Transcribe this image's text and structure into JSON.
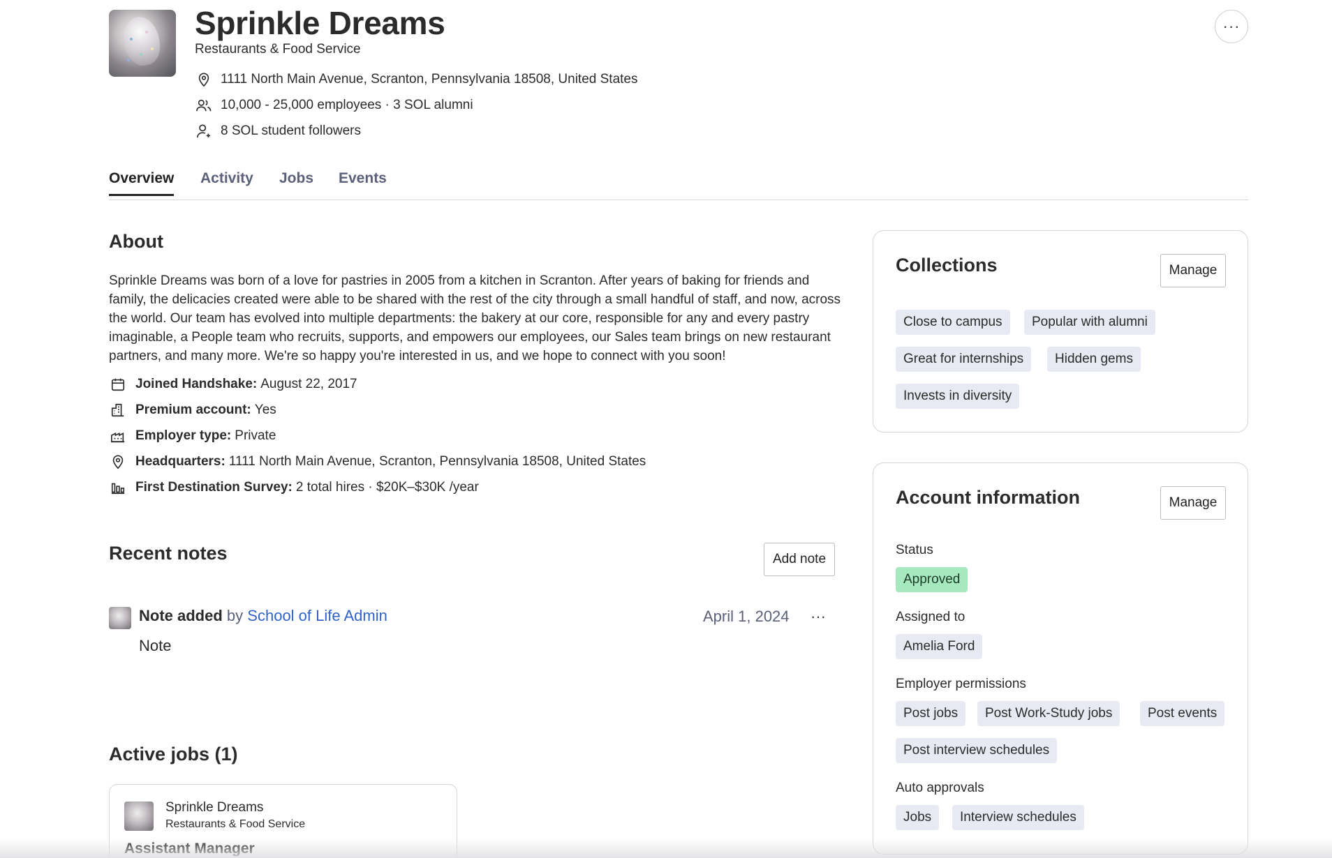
{
  "company": {
    "name": "Sprinkle Dreams",
    "industry": "Restaurants & Food Service",
    "address": "1111 North Main Avenue, Scranton, Pennsylvania 18508, United States",
    "employees": "10,000 - 25,000 employees · 3 SOL alumni",
    "followers": "8 SOL student followers",
    "more_icon": "more-horizontal-icon"
  },
  "tabs": [
    {
      "label": "Overview",
      "active": true
    },
    {
      "label": "Activity",
      "active": false
    },
    {
      "label": "Jobs",
      "active": false
    },
    {
      "label": "Events",
      "active": false
    }
  ],
  "about": {
    "heading": "About",
    "text": "Sprinkle Dreams was born of a love for pastries in 2005 from a kitchen in Scranton. After years of baking for friends and family, the delicacies created were able to be shared with the rest of the city through a small handful of staff, and now, across the world. Our team has evolved into multiple departments: the bakery at our core, responsible for any and every pastry imaginable, a People team who recruits, supports, and empowers our employees, our Sales team brings on new restaurant partners, and many more. We're so happy you're interested in us, and we hope to connect with you soon!",
    "details": [
      {
        "label": "Joined Handshake:",
        "value": "August 22, 2017",
        "icon": "calendar-icon"
      },
      {
        "label": "Premium account:",
        "value": "Yes",
        "icon": "building-icon"
      },
      {
        "label": "Employer type:",
        "value": "Private",
        "icon": "factory-icon"
      },
      {
        "label": "Headquarters:",
        "value": "1111 North Main Avenue, Scranton, Pennsylvania 18508, United States",
        "icon": "location-pin-icon"
      },
      {
        "label": "First Destination Survey:",
        "value": "2 total hires · $20K–$30K /year",
        "icon": "bar-chart-icon"
      }
    ]
  },
  "notes": {
    "heading": "Recent notes",
    "add_label": "Add note",
    "items": [
      {
        "title": "Note added",
        "by": "by",
        "author": "School of Life Admin",
        "date": "April 1, 2024",
        "body": "Note"
      }
    ]
  },
  "jobs": {
    "heading": "Active jobs (1)",
    "items": [
      {
        "company": "Sprinkle Dreams",
        "industry": "Restaurants & Food Service",
        "title": "Assistant Manager"
      }
    ]
  },
  "collections": {
    "title": "Collections",
    "manage_label": "Manage",
    "tags": [
      "Close to campus",
      "Popular with alumni",
      "Great for internships",
      "Hidden gems",
      "Invests in diversity"
    ]
  },
  "account": {
    "title": "Account information",
    "manage_label": "Manage",
    "status_label": "Status",
    "status_value": "Approved",
    "status_color": "#a6e9be",
    "assigned_label": "Assigned to",
    "assigned_value": "Amelia Ford",
    "permissions_label": "Employer permissions",
    "permissions": [
      "Post jobs",
      "Post Work-Study jobs",
      "Post events",
      "Post interview schedules"
    ],
    "auto_label": "Auto approvals",
    "auto": [
      "Jobs",
      "Interview schedules"
    ]
  },
  "colors": {
    "link": "#2f63c9",
    "tag_bg": "#e8eaf3",
    "muted_text": "#5b6079"
  }
}
